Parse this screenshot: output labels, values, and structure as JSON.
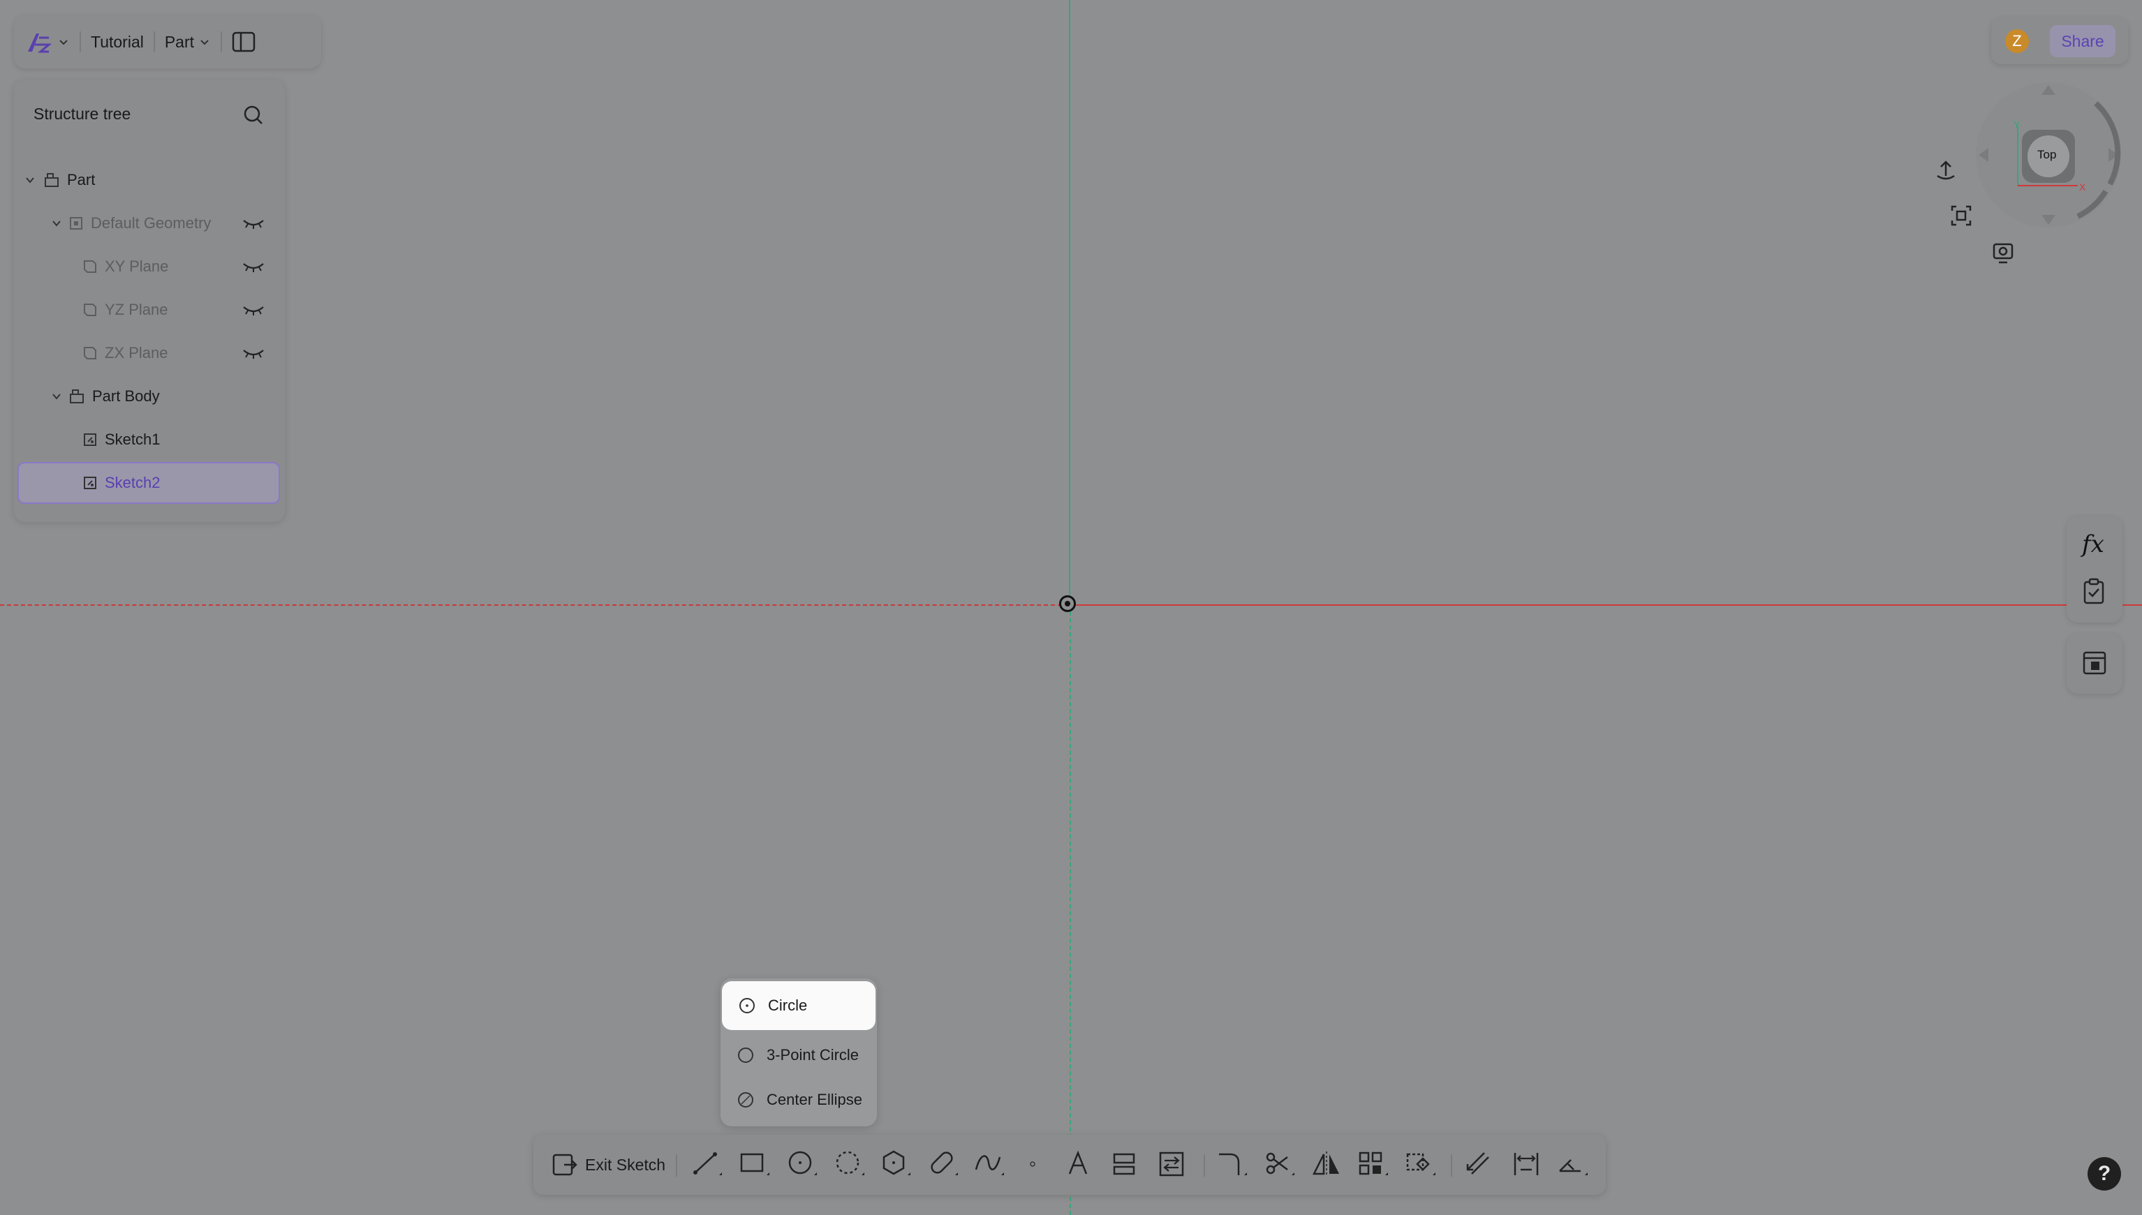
{
  "topbar": {
    "logo_icon": "app-logo-icon",
    "document_name": "Tutorial",
    "mode_label": "Part"
  },
  "structure_tree": {
    "title": "Structure tree",
    "items": [
      {
        "label": "Part",
        "icon": "part-icon",
        "expanded": true,
        "visible_toggle": false
      },
      {
        "label": "Default Geometry",
        "icon": "geometry-folder-icon",
        "expanded": true,
        "visible_toggle": true
      },
      {
        "label": "XY Plane",
        "icon": "plane-icon",
        "visible_toggle": true
      },
      {
        "label": "YZ Plane",
        "icon": "plane-icon",
        "visible_toggle": true
      },
      {
        "label": "ZX Plane",
        "icon": "plane-icon",
        "visible_toggle": true
      },
      {
        "label": "Part Body",
        "icon": "part-body-icon",
        "expanded": true,
        "visible_toggle": false
      },
      {
        "label": "Sketch1",
        "icon": "sketch-icon",
        "visible_toggle": false
      },
      {
        "label": "Sketch2",
        "icon": "sketch-icon",
        "selected": true,
        "visible_toggle": false
      }
    ]
  },
  "header_right": {
    "avatar_initial": "Z",
    "share_label": "Share"
  },
  "view_cube": {
    "face_label": "Top",
    "axis_y": "Y",
    "axis_x": "X"
  },
  "right_tools": {
    "fx_label": "fx"
  },
  "circle_menu": {
    "items": [
      {
        "label": "Circle",
        "icon": "center-circle-icon",
        "active": true
      },
      {
        "label": "3-Point Circle",
        "icon": "three-point-circle-icon"
      },
      {
        "label": "Center Ellipse",
        "icon": "ellipse-icon"
      }
    ]
  },
  "bottom_toolbar": {
    "exit_label": "Exit Sketch",
    "tools": [
      "line-icon",
      "rectangle-icon",
      "circle-icon",
      "arc-icon",
      "polygon-icon",
      "slot-icon",
      "spline-icon",
      "point-icon",
      "text-icon",
      "project-icon",
      "convert-icon",
      "fillet-icon",
      "trim-icon",
      "mirror-icon",
      "pattern-icon",
      "transform-icon",
      "offset-icon",
      "dimension-icon",
      "constraint-icon"
    ]
  },
  "colors": {
    "accent": "#5b44b3",
    "x_axis": "#cf3a3a",
    "y_axis": "#3aa57a",
    "canvas": "#8e8f91"
  }
}
